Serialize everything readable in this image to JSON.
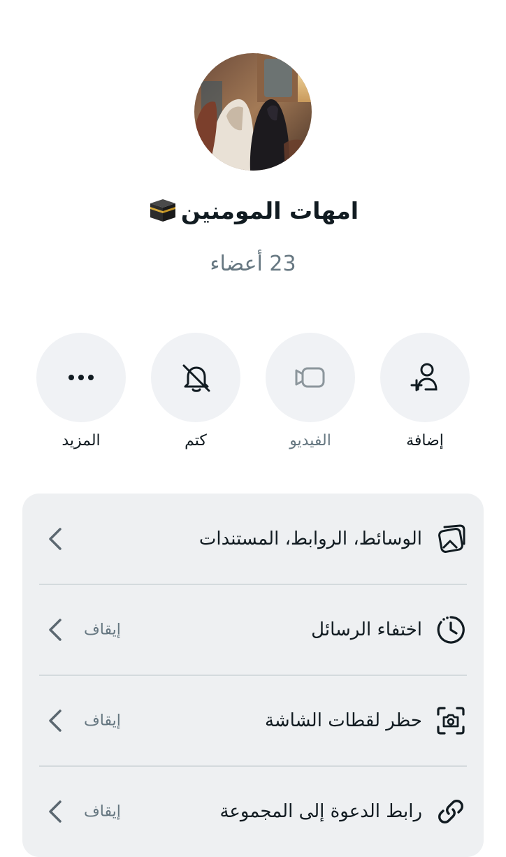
{
  "group": {
    "name": "امهات المومنين",
    "emoji_icon": "kaaba-icon",
    "members": "23 أعضاء"
  },
  "actions": [
    {
      "id": "add",
      "label": "إضافة",
      "icon": "add-person-icon"
    },
    {
      "id": "video",
      "label": "الفيديو",
      "icon": "video-camera-icon",
      "disabled": true
    },
    {
      "id": "mute",
      "label": "كتم",
      "icon": "bell-off-icon"
    },
    {
      "id": "more",
      "label": "المزيد",
      "icon": "more-dots-icon"
    }
  ],
  "settings": [
    {
      "label": "الوسائط، الروابط، المستندات",
      "value": "",
      "icon": "media-gallery-icon"
    },
    {
      "label": "اختفاء الرسائل",
      "value": "إيقاف",
      "icon": "timer-icon"
    },
    {
      "label": "حظر لقطات الشاشة",
      "value": "إيقاف",
      "icon": "screenshot-camera-icon"
    },
    {
      "label": "رابط الدعوة إلى المجموعة",
      "value": "إيقاف",
      "icon": "link-icon"
    }
  ],
  "colors": {
    "background": "#ffffff",
    "card": "#eef0f2",
    "action_circle": "#f0f2f5",
    "secondary_text": "#667781",
    "icon": "#111b21",
    "chevron": "#5b6770"
  }
}
